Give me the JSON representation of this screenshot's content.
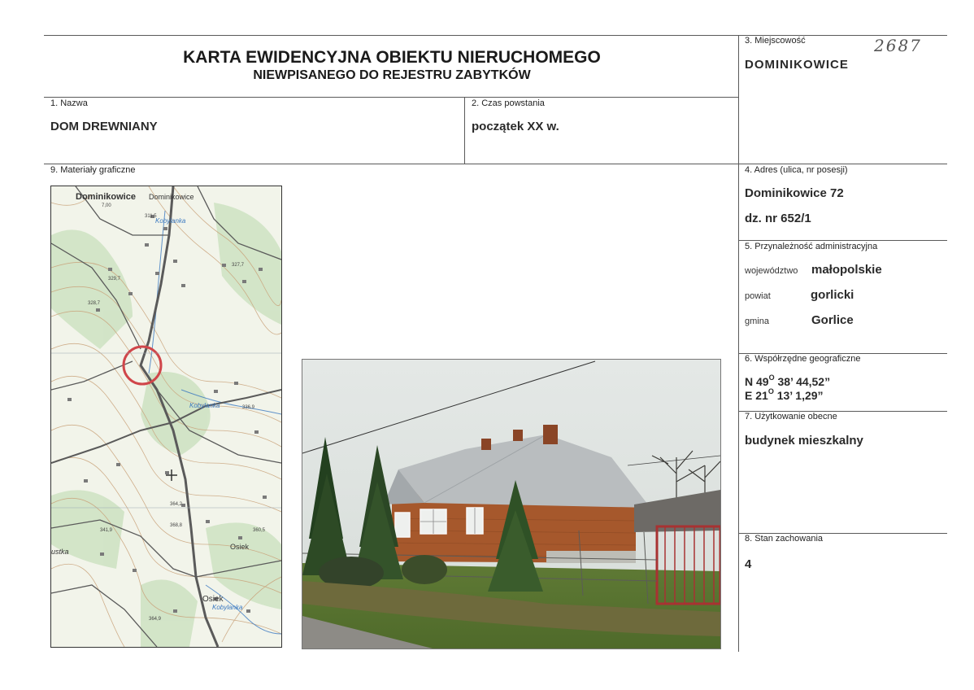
{
  "header": {
    "title": "KARTA EWIDENCYJNA OBIEKTU NIERUCHOMEGO",
    "subtitle": "NIEWPISANEGO DO REJESTRU ZABYTKÓW",
    "handwritten_number": "2687"
  },
  "fields": {
    "miejscowosc": {
      "label": "3. Miejscowość",
      "value": "DOMINIKOWICE"
    },
    "nazwa": {
      "label": "1. Nazwa",
      "value": "DOM DREWNIANY"
    },
    "czas": {
      "label": "2. Czas powstania",
      "value": "początek XX w."
    },
    "materialy": {
      "label": "9. Materiały graficzne"
    },
    "adres": {
      "label": "4. Adres (ulica, nr posesji)",
      "line1": "Dominikowice 72",
      "line2": "dz. nr 652/1"
    },
    "przynaleznosc": {
      "label": "5. Przynależność administracyjna",
      "wojewodztwo_label": "województwo",
      "wojewodztwo": "małopolskie",
      "powiat_label": "powiat",
      "powiat": "gorlicki",
      "gmina_label": "gmina",
      "gmina": "Gorlice"
    },
    "wspolrzedne": {
      "label": "6. Współrzędne geograficzne",
      "n_prefix": "N 49",
      "n_deg": "O",
      "n_rest": " 38’ 44,52”",
      "e_prefix": "E 21",
      "e_deg": "O",
      "e_rest": " 13’ 1,29”"
    },
    "uzytkowanie": {
      "label": "7. Użytkowanie obecne",
      "value": "budynek mieszkalny"
    },
    "stan": {
      "label": "8. Stan zachowania",
      "value": "4"
    }
  },
  "map": {
    "labels": {
      "town1": "Dominikowice",
      "town2": "Dominikowice",
      "river1": "Kobylanka",
      "river2": "Kobylanka",
      "river3": "Kobylanka",
      "village1": "Osiek",
      "village2": "Osiek",
      "edge": "ustka",
      "h1": "7,00",
      "h2": "311,5",
      "h3": "329,7",
      "h4": "328,7",
      "h5": "327,7",
      "h6": "336,9",
      "h7": "364,2",
      "h8": "368,8",
      "h9": "341,9",
      "h10": "360,5",
      "h11": "364,9"
    },
    "colors": {
      "road": "#5a5a5a",
      "contour": "#c9a27a",
      "marker": "#d0464a",
      "water": "#3a78c0"
    }
  }
}
